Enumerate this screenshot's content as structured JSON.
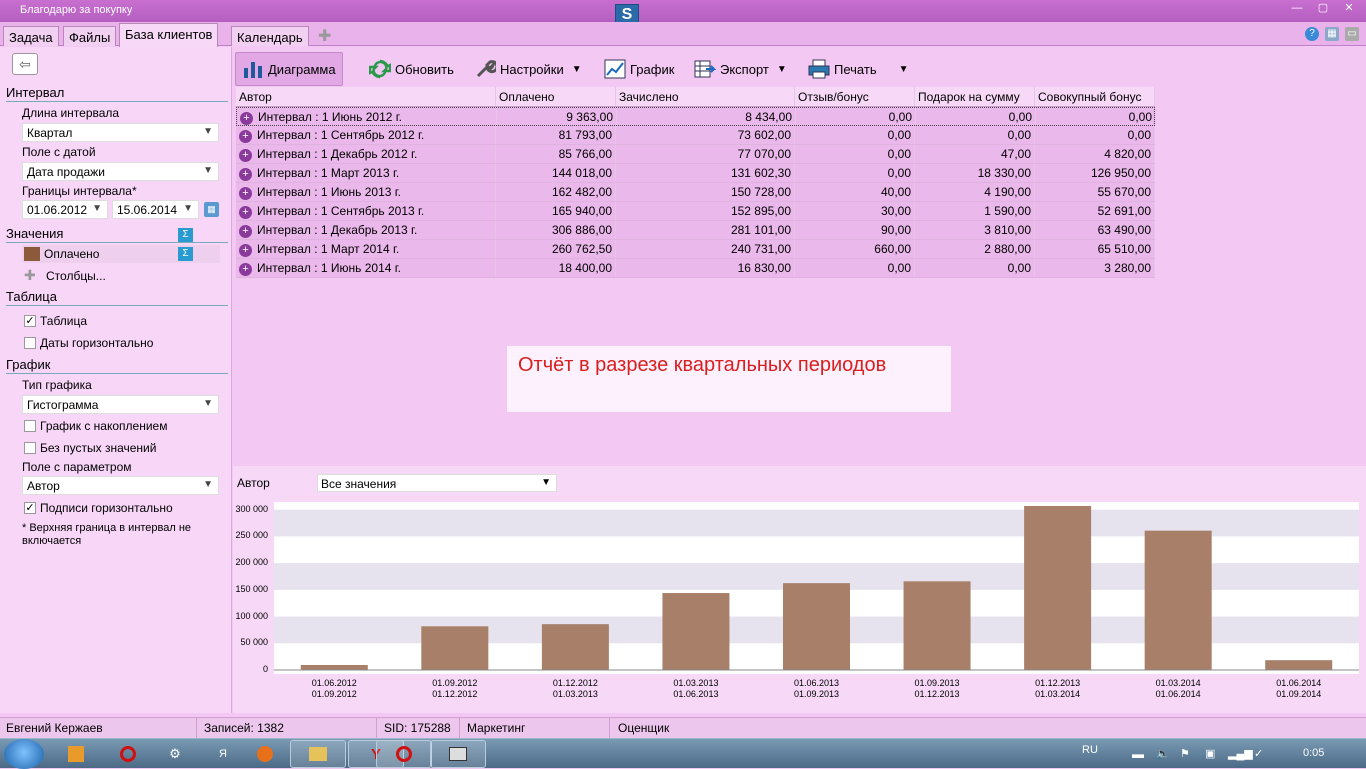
{
  "window": {
    "title": "Благодарю за покупку"
  },
  "tabs": [
    "Задача",
    "Файлы",
    "База клиентов",
    "Календарь"
  ],
  "sidebar": {
    "interval_header": "Интервал",
    "interval_length_label": "Длина интервала",
    "interval_length_value": "Квартал",
    "date_field_label": "Поле с датой",
    "date_field_value": "Дата продажи",
    "bounds_label": "Границы интервала*",
    "date_from": "01.06.2012",
    "date_to": "15.06.2014",
    "values_header": "Значения",
    "value_item": "Оплачено",
    "columns_link": "Столбцы...",
    "table_header": "Таблица",
    "table_check": "Таблица",
    "dates_horizontal": "Даты горизонтально",
    "chart_header": "График",
    "chart_type_label": "Тип графика",
    "chart_type_value": "Гистограмма",
    "cumulative": "График с накоплением",
    "no_empty": "Без пустых значений",
    "param_label": "Поле с параметром",
    "param_value": "Автор",
    "labels_horizontal": "Подписи горизонтально",
    "footnote": "* Верхняя граница в интервал не включается"
  },
  "toolbar": {
    "diagram": "Диаграмма",
    "refresh": "Обновить",
    "settings": "Настройки",
    "graph": "График",
    "export": "Экспорт",
    "print": "Печать"
  },
  "grid": {
    "columns": [
      "Автор",
      "Оплачено",
      "Зачислено",
      "Отзыв/бонус",
      "Подарок на сумму",
      "Совокупный бонус"
    ],
    "rows": [
      [
        "Интервал : 1 Июнь 2012 г.",
        "9 363,00",
        "8 434,00",
        "0,00",
        "0,00",
        "0,00"
      ],
      [
        "Интервал : 1 Сентябрь 2012 г.",
        "81 793,00",
        "73 602,00",
        "0,00",
        "0,00",
        "0,00"
      ],
      [
        "Интервал : 1 Декабрь 2012 г.",
        "85 766,00",
        "77 070,00",
        "0,00",
        "47,00",
        "4 820,00"
      ],
      [
        "Интервал : 1 Март 2013 г.",
        "144 018,00",
        "131 602,30",
        "0,00",
        "18 330,00",
        "126 950,00"
      ],
      [
        "Интервал : 1 Июнь 2013 г.",
        "162 482,00",
        "150 728,00",
        "40,00",
        "4 190,00",
        "55 670,00"
      ],
      [
        "Интервал : 1 Сентябрь 2013 г.",
        "165 940,00",
        "152 895,00",
        "30,00",
        "1 590,00",
        "52 691,00"
      ],
      [
        "Интервал : 1 Декабрь 2013 г.",
        "306 886,00",
        "281 101,00",
        "90,00",
        "3 810,00",
        "63 490,00"
      ],
      [
        "Интервал : 1 Март 2014 г.",
        "260 762,50",
        "240 731,00",
        "660,00",
        "2 880,00",
        "65 510,00"
      ],
      [
        "Интервал : 1 Июнь 2014 г.",
        "18 400,00",
        "16 830,00",
        "0,00",
        "0,00",
        "3 280,00"
      ]
    ]
  },
  "note": "Отчёт в разрезе квартальных периодов",
  "chart_filter": {
    "label": "Автор",
    "value": "Все значения"
  },
  "chart_data": {
    "type": "bar",
    "categories": [
      "01.06.2012 01.09.2012",
      "01.09.2012 01.12.2012",
      "01.12.2012 01.03.2013",
      "01.03.2013 01.06.2013",
      "01.06.2013 01.09.2013",
      "01.09.2013 01.12.2013",
      "01.12.2013 01.03.2014",
      "01.03.2014 01.06.2014",
      "01.06.2014 01.09.2014"
    ],
    "labels_top": [
      "01.06.2012",
      "01.09.2012",
      "01.12.2012",
      "01.03.2013",
      "01.06.2013",
      "01.09.2013",
      "01.12.2013",
      "01.03.2014",
      "01.06.2014"
    ],
    "labels_bottom": [
      "01.09.2012",
      "01.12.2012",
      "01.03.2013",
      "01.06.2013",
      "01.09.2013",
      "01.12.2013",
      "01.03.2014",
      "01.06.2014",
      "01.09.2014"
    ],
    "values": [
      9363,
      81793,
      85766,
      144018,
      162482,
      165940,
      306886,
      260762.5,
      18400
    ],
    "yticks": [
      "0",
      "50 000",
      "100 000",
      "150 000",
      "200 000",
      "250 000",
      "300 000"
    ],
    "ylim": [
      0,
      306886
    ],
    "bar_color": "#a8806a",
    "grid": true
  },
  "status": {
    "user": "Евгений Кержаев",
    "records": "Записей: 1382",
    "sid": "SID: 175288",
    "dept": "Маркетинг",
    "role": "Оценщик"
  },
  "tray": {
    "lang": "RU",
    "time": "0:05"
  }
}
